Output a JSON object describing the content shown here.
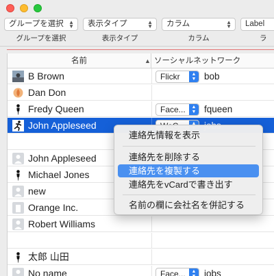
{
  "toolbar": {
    "items": [
      {
        "value": "グループを選択",
        "label": "グループを選択"
      },
      {
        "value": "表示タイプ",
        "label": "表示タイプ"
      },
      {
        "value": "カラム",
        "label": "カラム"
      },
      {
        "value": "Label",
        "label": "ラ"
      }
    ]
  },
  "table": {
    "columns": {
      "name": "名前",
      "social": "ソーシャルネットワーク"
    },
    "rows": [
      {
        "name": "B Brown",
        "avatar": "photo-avatar-icon",
        "service": "Flickr",
        "handle": "bob"
      },
      {
        "name": "Dan Don",
        "avatar": "shell-avatar-icon",
        "service": "",
        "handle": ""
      },
      {
        "name": "Fredy Queen",
        "avatar": "silhouette-avatar-icon",
        "service": "Face...",
        "handle": "fqueen"
      },
      {
        "name": "John Appleseed",
        "avatar": "runner-avatar-icon",
        "service": "WeC...",
        "handle": "jobs"
      },
      {
        "name": "",
        "avatar": "",
        "service": "",
        "handle": ""
      },
      {
        "name": "John Appleseed",
        "avatar": "person-placeholder-icon",
        "service": "",
        "handle": ""
      },
      {
        "name": "Michael Jones",
        "avatar": "silhouette-avatar-icon",
        "service": "",
        "handle": ""
      },
      {
        "name": "new",
        "avatar": "person-placeholder-icon",
        "service": "",
        "handle": ""
      },
      {
        "name": "Orange Inc.",
        "avatar": "building-placeholder-icon",
        "service": "",
        "handle": ""
      },
      {
        "name": "Robert Williams",
        "avatar": "person-placeholder-icon",
        "service": "",
        "handle": ""
      },
      {
        "name": "",
        "avatar": "",
        "service": "",
        "handle": ""
      },
      {
        "name": "太郎 山田",
        "avatar": "silhouette-avatar-icon",
        "service": "",
        "handle": ""
      },
      {
        "name": "No name",
        "avatar": "person-placeholder-icon",
        "service": "Face...",
        "handle": "jobs"
      }
    ],
    "selected_index": 3
  },
  "context_menu": {
    "items": [
      {
        "label": "連絡先情報を表示"
      },
      {
        "label": "連絡先を削除する"
      },
      {
        "label": "連絡先を複製する"
      },
      {
        "label": "連絡先をvCardで書き出す"
      },
      {
        "label": "名前の欄に会社名を併記する"
      }
    ],
    "highlighted_index": 2
  },
  "colors": {
    "accent": "#1560d8",
    "highlight": "#4a90f0",
    "stepper": "#2f80f0"
  }
}
